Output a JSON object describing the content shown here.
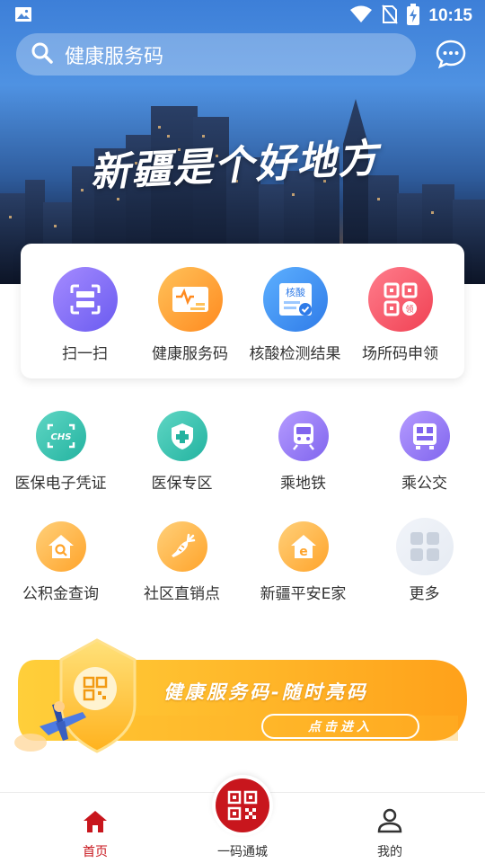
{
  "status_bar": {
    "time": "10:15",
    "icons": [
      "image-icon",
      "wifi-icon",
      "no-sim-icon",
      "battery-charging-icon"
    ]
  },
  "search": {
    "placeholder": "健康服务码",
    "icon": "search-icon"
  },
  "header": {
    "message_icon": "chat-bubble-icon"
  },
  "banner_top": {
    "slogan": "新疆是个好地方"
  },
  "quick_actions": [
    {
      "label": "扫一扫",
      "icon": "scan-icon",
      "color_from": "#a58bff",
      "color_to": "#6a5bf0"
    },
    {
      "label": "健康服务码",
      "icon": "health-card-icon",
      "color_from": "#ffc25a",
      "color_to": "#ff8a1f"
    },
    {
      "label": "核酸检测结果",
      "icon": "nucleic-test-icon",
      "color_from": "#5db0ff",
      "color_to": "#2f7be8"
    },
    {
      "label": "场所码申领",
      "icon": "venue-code-icon",
      "color_from": "#ff7d8c",
      "color_to": "#f04153"
    }
  ],
  "services_row1": [
    {
      "label": "医保电子凭证",
      "icon": "chs-card-icon",
      "color_from": "#5fd6c4",
      "color_to": "#23b3a0"
    },
    {
      "label": "医保专区",
      "icon": "medical-shield-icon",
      "color_from": "#5fd6c4",
      "color_to": "#23b3a0"
    },
    {
      "label": "乘地铁",
      "icon": "metro-icon",
      "color_from": "#b59bff",
      "color_to": "#8065ee"
    },
    {
      "label": "乘公交",
      "icon": "bus-qr-icon",
      "color_from": "#b59bff",
      "color_to": "#8065ee"
    }
  ],
  "services_row2": [
    {
      "label": "公积金查询",
      "icon": "housing-fund-icon",
      "color_from": "#ffd07a",
      "color_to": "#ffa42b"
    },
    {
      "label": "社区直销点",
      "icon": "carrot-icon",
      "color_from": "#ffd07a",
      "color_to": "#ffa42b"
    },
    {
      "label": "新疆平安E家",
      "icon": "e-home-icon",
      "color_from": "#ffd07a",
      "color_to": "#ffa42b"
    },
    {
      "label": "更多",
      "icon": "more-grid-icon",
      "color_from": "#f1f4f9",
      "color_to": "#e6ebf3"
    }
  ],
  "promo_banner": {
    "title": "健康服务码-随时亮码",
    "button": "点击进入",
    "icon": "qr-shield-icon"
  },
  "bottom_nav": {
    "home": "首页",
    "center": "一码通城",
    "mine": "我的"
  },
  "colors": {
    "accent_red": "#c8161d",
    "promo_orange": "#ffac1c"
  }
}
